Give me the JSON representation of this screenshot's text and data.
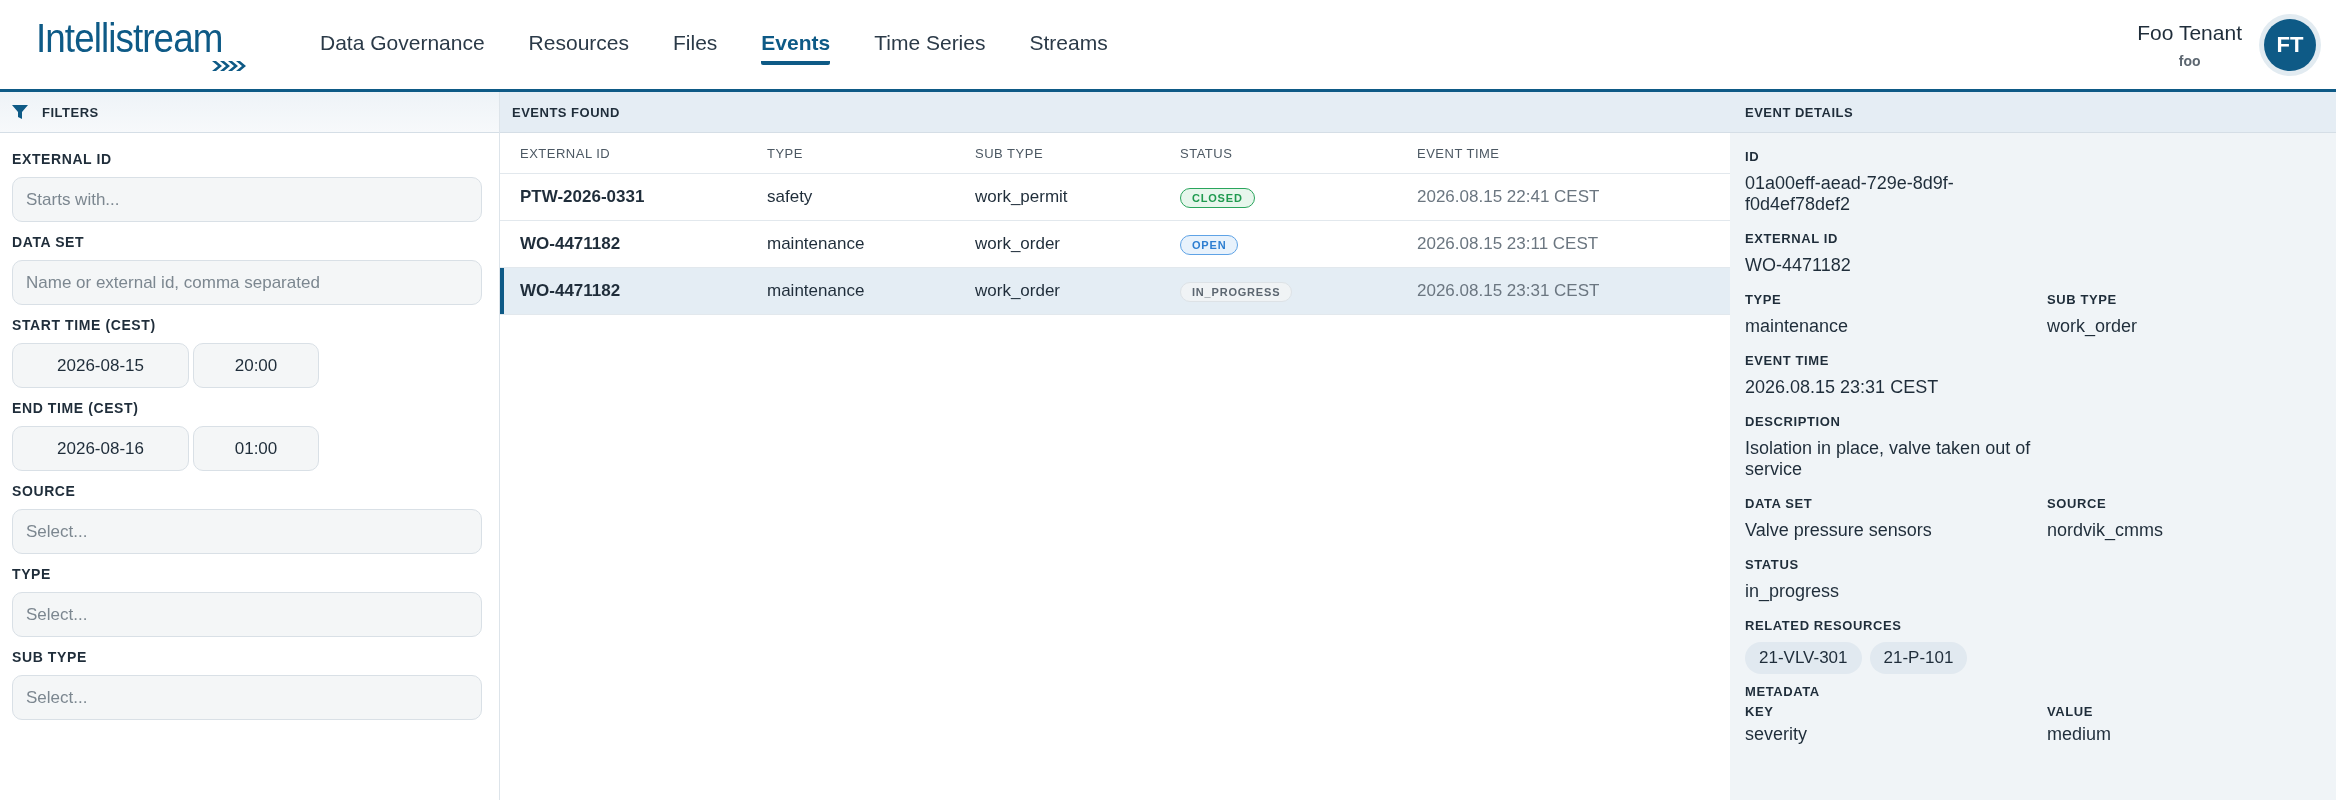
{
  "header": {
    "logo": "Intellistream",
    "nav": [
      {
        "label": "Data Governance",
        "selected": false
      },
      {
        "label": "Resources",
        "selected": false
      },
      {
        "label": "Files",
        "selected": false
      },
      {
        "label": "Events",
        "selected": true
      },
      {
        "label": "Time Series",
        "selected": false
      },
      {
        "label": "Streams",
        "selected": false
      }
    ],
    "user": {
      "name": "Foo Tenant",
      "tenant": "foo",
      "initials": "FT"
    }
  },
  "filters": {
    "title": "FILTERS",
    "fields": [
      {
        "kind": "text",
        "label": "EXTERNAL ID",
        "placeholder": "Starts with..."
      },
      {
        "kind": "text",
        "label": "DATA SET",
        "placeholder": "Name or external id, comma separated"
      },
      {
        "kind": "datetime",
        "label": "START TIME (CEST)",
        "date": "2026-08-15",
        "time": "20:00"
      },
      {
        "kind": "datetime",
        "label": "END TIME (CEST)",
        "date": "2026-08-16",
        "time": "01:00"
      },
      {
        "kind": "text",
        "label": "SOURCE",
        "placeholder": "Select..."
      },
      {
        "kind": "text",
        "label": "TYPE",
        "placeholder": "Select..."
      },
      {
        "kind": "text",
        "label": "SUB TYPE",
        "placeholder": "Select..."
      }
    ]
  },
  "events": {
    "title": "EVENTS FOUND",
    "columns": [
      "EXTERNAL ID",
      "TYPE",
      "SUB TYPE",
      "STATUS",
      "EVENT TIME"
    ],
    "rows": [
      {
        "external_id": "PTW-2026-0331",
        "type": "safety",
        "sub_type": "work_permit",
        "status": {
          "text": "CLOSED",
          "kind": "closed"
        },
        "event_time": "2026.08.15 22:41 CEST",
        "selected": false
      },
      {
        "external_id": "WO-4471182",
        "type": "maintenance",
        "sub_type": "work_order",
        "status": {
          "text": "OPEN",
          "kind": "open"
        },
        "event_time": "2026.08.15 23:11 CEST",
        "selected": false
      },
      {
        "external_id": "WO-4471182",
        "type": "maintenance",
        "sub_type": "work_order",
        "status": {
          "text": "IN_PROGRESS",
          "kind": "in_progress"
        },
        "event_time": "2026.08.15 23:31 CEST",
        "selected": true
      }
    ]
  },
  "details": {
    "title": "EVENT DETAILS",
    "sections": [
      {
        "kind": "fields",
        "fields": [
          {
            "label": "ID",
            "value": "01a00eff-aead-729e-8d9f-f0d4ef78def2"
          }
        ]
      },
      {
        "kind": "fields",
        "fields": [
          {
            "label": "EXTERNAL ID",
            "value": "WO-4471182"
          }
        ]
      },
      {
        "kind": "fields",
        "fields": [
          {
            "label": "TYPE",
            "value": "maintenance"
          },
          {
            "label": "SUB TYPE",
            "value": "work_order"
          }
        ]
      },
      {
        "kind": "fields",
        "fields": [
          {
            "label": "EVENT TIME",
            "value": "2026.08.15 23:31 CEST"
          }
        ]
      },
      {
        "kind": "fields",
        "fields": [
          {
            "label": "DESCRIPTION",
            "value": "Isolation in place, valve taken out of service"
          }
        ]
      },
      {
        "kind": "fields",
        "fields": [
          {
            "label": "DATA SET",
            "value": "Valve pressure sensors"
          },
          {
            "label": "SOURCE",
            "value": "nordvik_cmms"
          }
        ]
      },
      {
        "kind": "fields",
        "fields": [
          {
            "label": "STATUS",
            "value": "in_progress"
          }
        ]
      },
      {
        "kind": "chips",
        "label": "RELATED RESOURCES",
        "chips": [
          "21-VLV-301",
          "21-P-101"
        ]
      },
      {
        "kind": "metadata",
        "label": "METADATA",
        "columns": [
          "KEY",
          "VALUE"
        ],
        "rows": [
          [
            "severity",
            "medium"
          ]
        ]
      }
    ]
  }
}
